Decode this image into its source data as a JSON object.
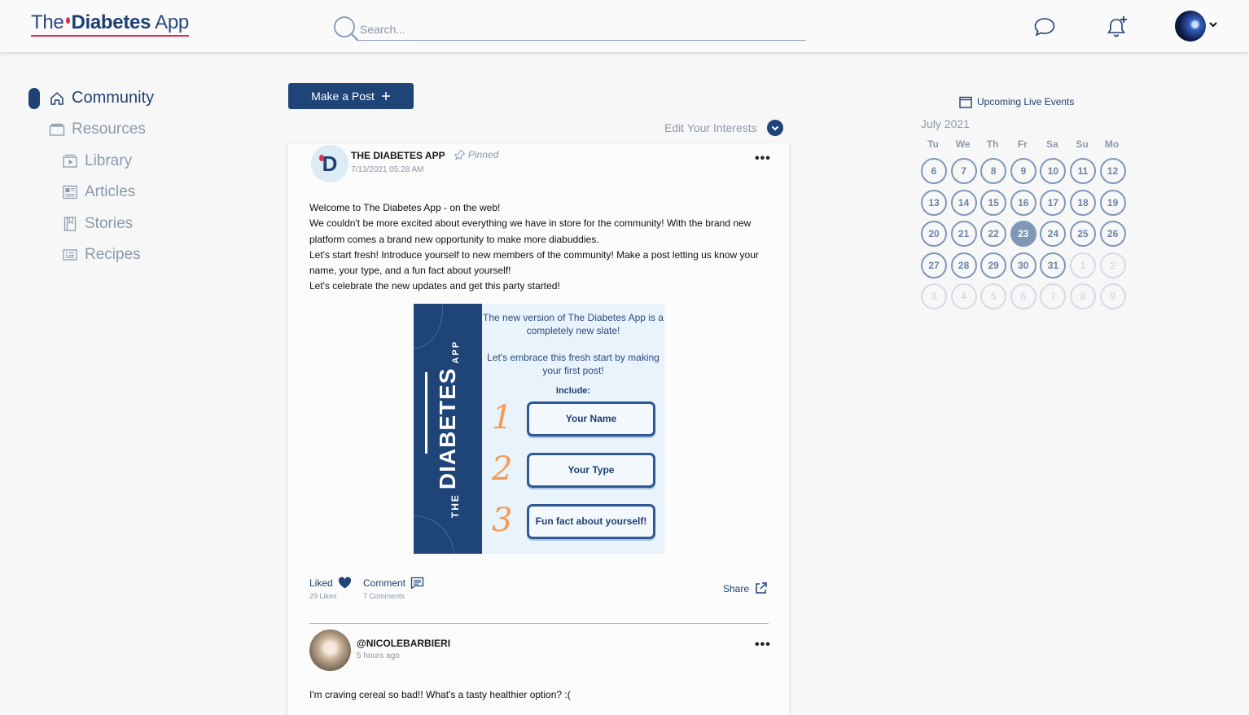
{
  "header": {
    "logo": {
      "the": "The",
      "brand": "Diabetes",
      "app": "App"
    },
    "search_placeholder": "Search..."
  },
  "sidebar": {
    "items": [
      {
        "label": "Community",
        "icon": "home-icon",
        "active": true
      },
      {
        "label": "Resources",
        "icon": "folder-icon"
      },
      {
        "label": "Library",
        "icon": "video-icon"
      },
      {
        "label": "Articles",
        "icon": "newspaper-icon"
      },
      {
        "label": "Stories",
        "icon": "book-icon"
      },
      {
        "label": "Recipes",
        "icon": "recipe-card-icon"
      }
    ]
  },
  "feed": {
    "make_post_label": "Make a Post",
    "edit_interests_label": "Edit Your Interests",
    "post1": {
      "author": "THE DIABETES APP",
      "pinned_label": "Pinned",
      "date": "7/13/2021 05:28 AM",
      "avatar_letter": "D",
      "body": [
        "Welcome to The Diabetes App - on the web!",
        "We couldn't be more excited about everything we have in store for the community! With the brand new platform comes a brand new opportunity to make more diabuddies.",
        "Let's start fresh! Introduce yourself to new members of the community! Make a post letting us know your name, your type, and a fun fact about yourself!",
        "Let's celebrate the new updates and get this party started!"
      ],
      "image": {
        "brand_the": "THE",
        "brand_main": "DIABETES",
        "brand_app": "APP",
        "line1": "The new version of The Diabetes App is a completely new slate!",
        "line2": "Let's embrace this fresh start by making your first post!",
        "include_label": "Include:",
        "steps": [
          {
            "num": "1",
            "text": "Your Name"
          },
          {
            "num": "2",
            "text": "Your Type"
          },
          {
            "num": "3",
            "text": "Fun fact about yourself!"
          }
        ]
      },
      "liked_label": "Liked",
      "likes_count": "29 Likes",
      "comment_label": "Comment",
      "comments_count": "7 Comments",
      "share_label": "Share"
    },
    "post2": {
      "author": "@NICOLEBARBIERI",
      "time": "5 hours ago",
      "body": "I'm craving cereal so bad!! What's a tasty healthier option? :("
    }
  },
  "events": {
    "title": "Upcoming Live Events",
    "month": "July 2021",
    "weekdays": [
      "Tu",
      "We",
      "Th",
      "Fr",
      "Sa",
      "Su",
      "Mo"
    ],
    "weeks": [
      [
        "6",
        "7",
        "8",
        "9",
        "10",
        "11",
        "12"
      ],
      [
        "13",
        "14",
        "15",
        "16",
        "17",
        "18",
        "19"
      ],
      [
        "20",
        "21",
        "22",
        "23",
        "24",
        "25",
        "26"
      ],
      [
        "27",
        "28",
        "29",
        "30",
        "31",
        "1",
        "2"
      ],
      [
        "3",
        "4",
        "5",
        "6",
        "7",
        "8",
        "9"
      ]
    ],
    "today": "23"
  },
  "colors": {
    "primary": "#1e4478",
    "accent_red": "#d9324a",
    "muted": "#8a9ab0",
    "promo_orange": "#f29a58"
  }
}
